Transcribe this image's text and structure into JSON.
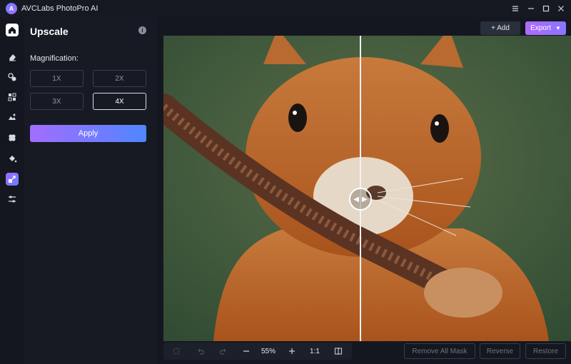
{
  "app": {
    "title": "AVCLabs PhotoPro AI",
    "logo_letter": "A"
  },
  "window_controls": [
    "menu-icon",
    "minimize-icon",
    "maximize-icon",
    "close-icon"
  ],
  "rail": {
    "items": [
      "home-icon",
      "eraser-icon",
      "face-icon",
      "object-icon",
      "background-icon",
      "colorize-icon",
      "fill-icon",
      "upscale-icon",
      "adjust-icon"
    ],
    "active": "upscale-icon"
  },
  "panel": {
    "title": "Upscale",
    "magnification_label": "Magnification:",
    "options": [
      "1X",
      "2X",
      "3X",
      "4X"
    ],
    "selected": "4X",
    "apply_label": "Apply"
  },
  "toolbar_top": {
    "add_label": "+ Add",
    "export_label": "Export"
  },
  "bottom_toolbar": {
    "zoom": "55%",
    "ratio": "1:1",
    "remove_all_mask": "Remove All Mask",
    "reverse": "Reverse",
    "restore": "Restore"
  },
  "colors": {
    "accent_purple": "#a36dff",
    "accent_blue": "#4f86ff",
    "panel_bg": "#171a23",
    "app_bg": "#14171f"
  }
}
